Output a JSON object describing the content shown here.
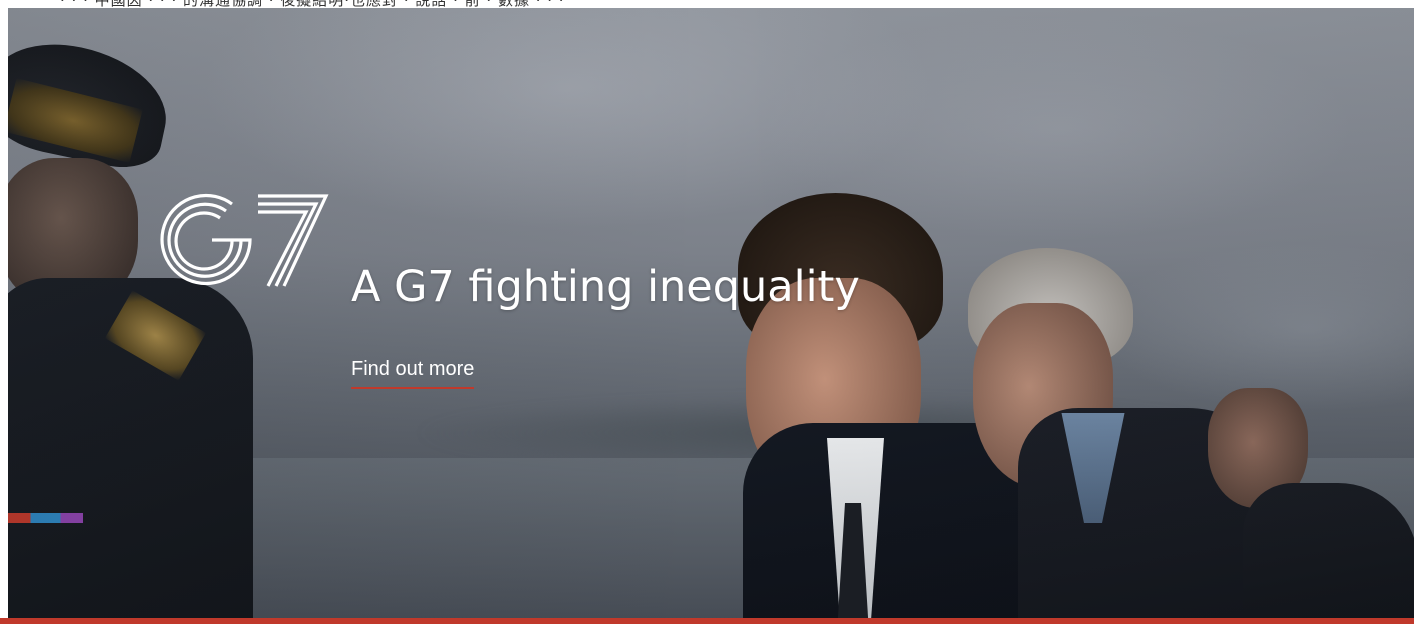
{
  "top_strip": {
    "text": "· · · 中國因 · · · 的溝通協調 · 後擬紹明·也應對 · 說話 · 前 · 數據 · · ·"
  },
  "hero": {
    "logo_text": "G7",
    "headline": "A G7 fighting inequality",
    "cta_label": "Find out more"
  },
  "colors": {
    "accent": "#c0392b",
    "headline": "#ffffff",
    "background_tone": "#6b717a"
  },
  "icons": {
    "logo": "g7-logo-icon"
  }
}
